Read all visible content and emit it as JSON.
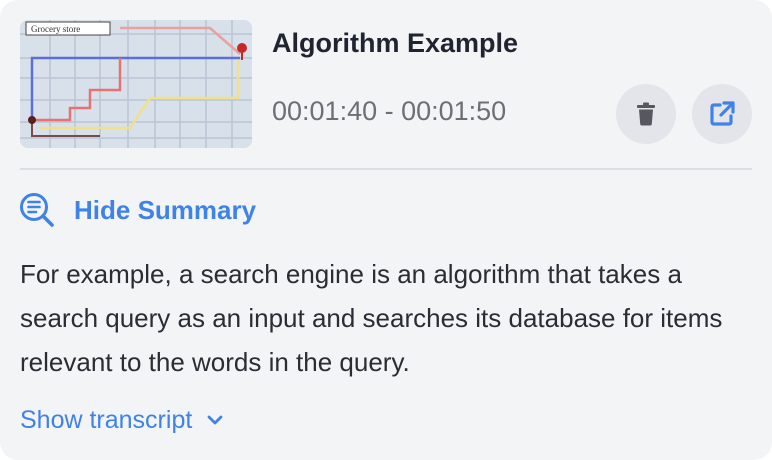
{
  "card": {
    "thumbnail": {
      "map_label": "Grocery store",
      "alt_icon": "map-thumbnail-icon"
    },
    "title": "Algorithm Example",
    "time_range": "00:01:40 - 00:01:50",
    "actions": {
      "delete_icon": "trash-icon",
      "open_icon": "external-link-icon"
    },
    "summary_toggle": {
      "icon": "search-summary-icon",
      "label": "Hide Summary"
    },
    "summary_text": "For example, a search engine is an algorithm that takes a search query as an input and searches its database for items relevant to the words in the query.",
    "transcript_toggle": {
      "label": "Show transcript",
      "icon": "chevron-down-icon"
    }
  },
  "colors": {
    "accent": "#3f82e8",
    "card_background": "#f3f4f6",
    "icon_button_background": "#e3e5ea",
    "title": "#1f2430",
    "muted_text": "#6b6f78"
  }
}
